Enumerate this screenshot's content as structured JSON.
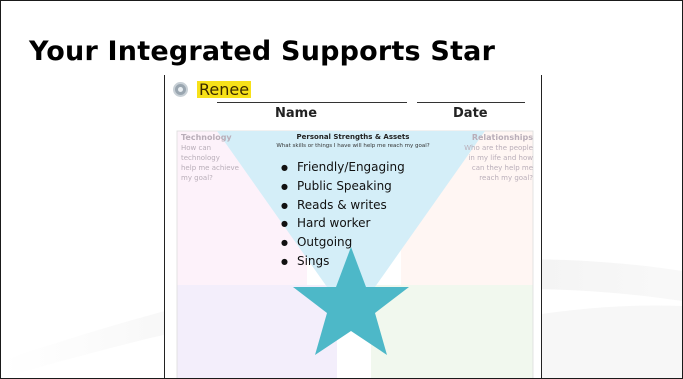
{
  "slide": {
    "title": "Your Integrated Supports Star"
  },
  "worksheet": {
    "student_name": "Renee",
    "name_label": "Name",
    "date_label": "Date",
    "left_corner": {
      "title": "Technology",
      "lines": [
        "How can",
        "technology",
        "help me achieve",
        "my goal?"
      ]
    },
    "right_corner": {
      "title": "Relationships",
      "lines": [
        "Who are the people",
        "in my life and how",
        "can they help me",
        "reach my goal?"
      ]
    },
    "strengths": {
      "heading": "Personal Strengths & Assets",
      "subheading": "What skills or things I have will help me reach my goal?",
      "items": [
        "Friendly/Engaging",
        "Public Speaking",
        "Reads & writes",
        "Hard worker",
        "Outgoing",
        "Sings"
      ]
    }
  },
  "colors": {
    "star": "#4db8c8",
    "strength_wedge": "#d4eef8",
    "name_highlight": "#f7e11a"
  },
  "icons": {
    "name_marker": "radio-disc-icon"
  }
}
